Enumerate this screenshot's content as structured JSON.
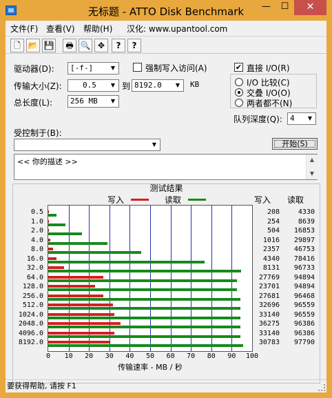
{
  "window": {
    "title": "无标题 - ATTO Disk Benchmark",
    "minimize": "—",
    "maximize": "☐",
    "close": "✕"
  },
  "menu": {
    "file": "文件(F)",
    "view": "查看(V)",
    "help": "帮助(H)",
    "localized": "汉化: www.upantool.com"
  },
  "toolbar": {
    "new": "🗋",
    "open": "📂",
    "save": "💾",
    "print": "🖶",
    "preview": "🔍",
    "move": "✥",
    "help": "?",
    "context_help": "?"
  },
  "settings": {
    "drive_label": "驱动器(D):",
    "drive_value": "[-f-]",
    "force_write_label": "强制写入访问(A)",
    "transfer_size_label": "传输大小(Z):",
    "transfer_from": "0.5",
    "transfer_to_word": "到",
    "transfer_to": "8192.0",
    "transfer_unit": "KB",
    "total_length_label": "总长度(L):",
    "total_length_value": "256 MB",
    "direct_io_label": "直接 I/O(R)",
    "direct_io_checked": "✔",
    "io_compare_label": "I/O 比较(C)",
    "overlapped_io_label": "交叠 I/O(O)",
    "neither_label": "两者都不(N)",
    "queue_depth_label": "队列深度(Q):",
    "queue_depth_value": "4",
    "controlled_by_label": "受控制于(B):",
    "controlled_by_value": "",
    "start_button": "开始(S)",
    "description_text": "<<  你的描述   >>"
  },
  "results": {
    "title": "测试结果",
    "write_legend": "写入",
    "read_legend": "读取",
    "write_header": "写入",
    "read_header": "读取",
    "x_axis_label": "传输速率 - MB / 秒"
  },
  "status": {
    "text": "要获得帮助, 请按 F1"
  },
  "colors": {
    "write": "#d42020",
    "read": "#178a1c",
    "grid": "#2233aa"
  },
  "chart_data": {
    "type": "bar",
    "orientation": "horizontal",
    "title": "测试结果",
    "xlabel": "传输速率 - MB / 秒",
    "ylabel": "",
    "xlim": [
      0,
      100
    ],
    "xticks": [
      "0",
      "10",
      "20",
      "30",
      "40",
      "50",
      "60",
      "70",
      "80",
      "90",
      "100"
    ],
    "categories": [
      "0.5",
      "1.0",
      "2.0",
      "4.0",
      "8.0",
      "16.0",
      "32.0",
      "64.0",
      "128.0",
      "256.0",
      "512.0",
      "1024.0",
      "2048.0",
      "4096.0",
      "8192.0"
    ],
    "series": [
      {
        "name": "写入",
        "values": [
          0.2,
          0.25,
          0.5,
          1.0,
          2.3,
          4.2,
          7.9,
          27.1,
          23.1,
          27.0,
          31.9,
          32.4,
          35.4,
          32.4,
          30.1
        ],
        "labels": [
          "208",
          "254",
          "504",
          "1016",
          "2357",
          "4340",
          "8131",
          "27769",
          "23701",
          "27681",
          "32696",
          "33140",
          "36275",
          "33140",
          "30783"
        ]
      },
      {
        "name": "读取",
        "values": [
          4.2,
          8.4,
          16.5,
          29.2,
          45.7,
          76.6,
          94.5,
          92.7,
          92.7,
          94.2,
          94.3,
          94.3,
          94.1,
          94.1,
          95.5
        ],
        "labels": [
          "4330",
          "8639",
          "16853",
          "29897",
          "46753",
          "78416",
          "96733",
          "94894",
          "94894",
          "96468",
          "96559",
          "96559",
          "96386",
          "96386",
          "97790"
        ]
      }
    ],
    "legend": "top",
    "grid": true
  }
}
